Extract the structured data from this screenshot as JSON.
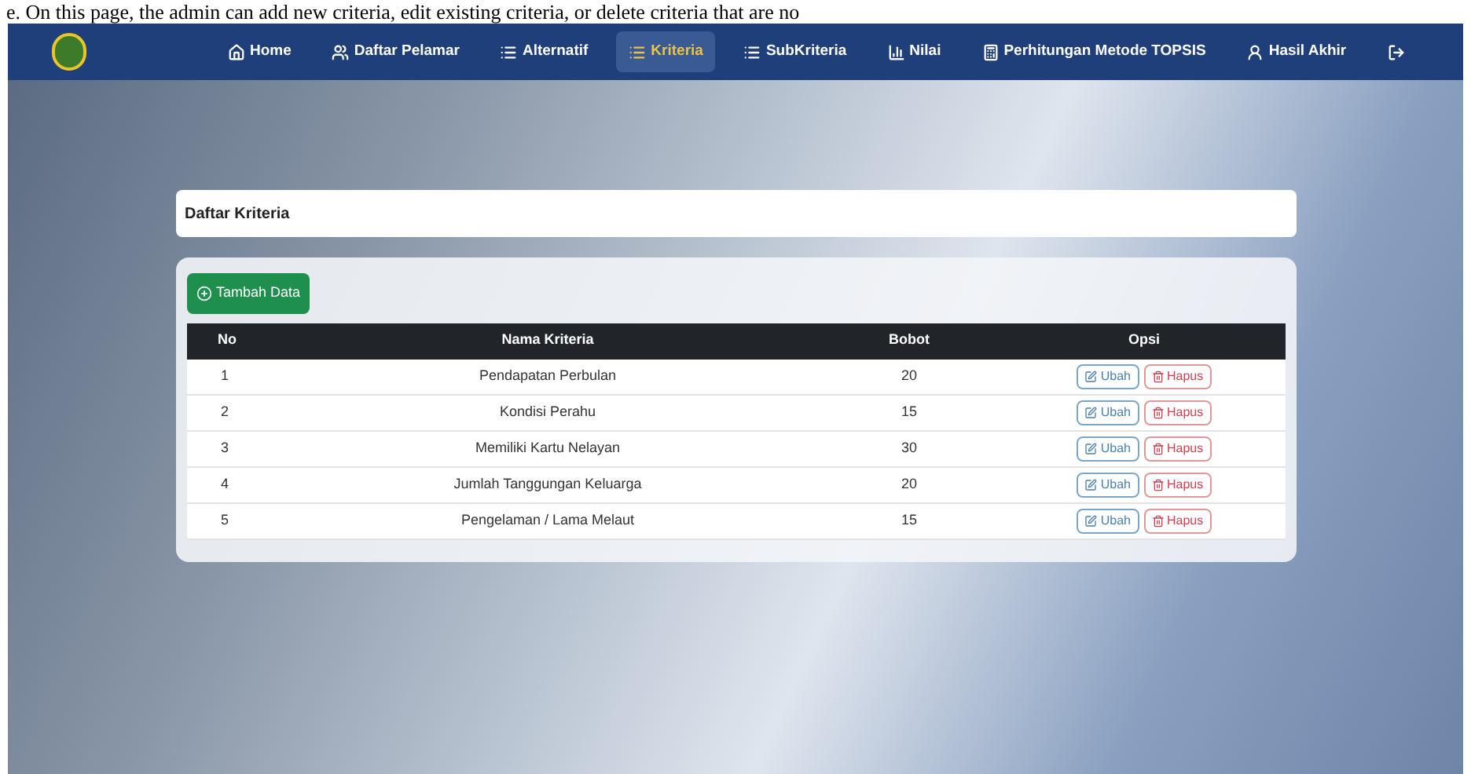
{
  "caption": "e. On this page, the admin can add new criteria, edit existing criteria, or delete criteria that are no",
  "navbar": {
    "items": [
      {
        "label": "Home",
        "selected": false
      },
      {
        "label": "Daftar Pelamar",
        "selected": false
      },
      {
        "label": "Alternatif",
        "selected": false
      },
      {
        "label": "Kriteria",
        "selected": true
      },
      {
        "label": "SubKriteria",
        "selected": false
      },
      {
        "label": "Nilai",
        "selected": false
      },
      {
        "label": "Perhitungan Metode TOPSIS",
        "selected": false
      },
      {
        "label": "Hasil Akhir",
        "selected": false
      }
    ]
  },
  "page_title": "Daftar Kriteria",
  "add_button": "Tambah Data",
  "table": {
    "columns": [
      "No",
      "Nama Kriteria",
      "Bobot",
      "Opsi"
    ],
    "rows": [
      {
        "no": "1",
        "name": "Pendapatan Perbulan",
        "weight": "20",
        "edit": "Ubah",
        "delete": "Hapus"
      },
      {
        "no": "2",
        "name": "Kondisi Perahu",
        "weight": "15",
        "edit": "Ubah",
        "delete": "Hapus"
      },
      {
        "no": "3",
        "name": "Memiliki Kartu Nelayan",
        "weight": "30",
        "edit": "Ubah",
        "delete": "Hapus"
      },
      {
        "no": "4",
        "name": "Jumlah Tanggungan Keluarga",
        "weight": "20",
        "edit": "Ubah",
        "delete": "Hapus"
      },
      {
        "no": "5",
        "name": "Pengelaman / Lama Melaut",
        "weight": "15",
        "edit": "Ubah",
        "delete": "Hapus"
      }
    ]
  }
}
